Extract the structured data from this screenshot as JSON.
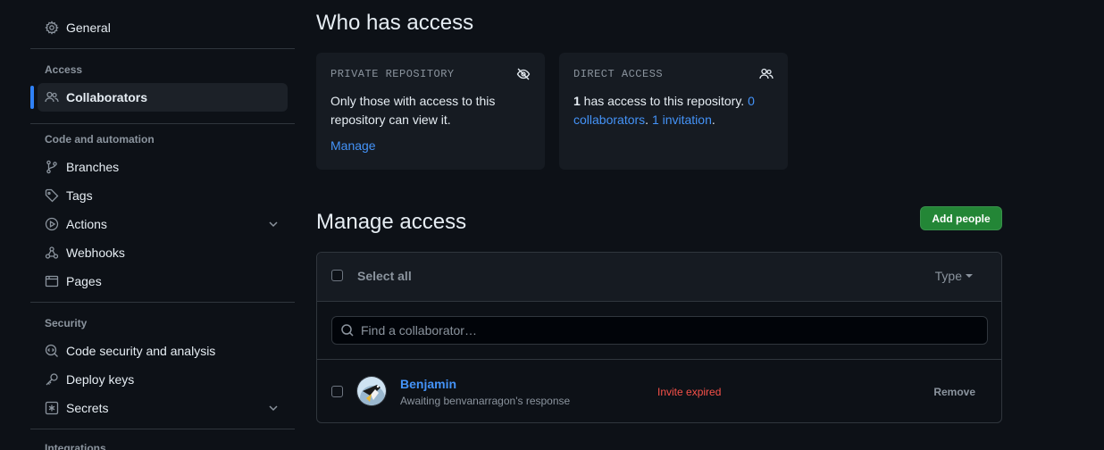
{
  "sidebar": {
    "general": "General",
    "sections": {
      "access": "Access",
      "code": "Code and automation",
      "security": "Security",
      "integrations": "Integrations"
    },
    "items": {
      "collaborators": "Collaborators",
      "branches": "Branches",
      "tags": "Tags",
      "actions": "Actions",
      "webhooks": "Webhooks",
      "pages": "Pages",
      "code_security": "Code security and analysis",
      "deploy_keys": "Deploy keys",
      "secrets": "Secrets"
    }
  },
  "who_has_access": {
    "title": "Who has access",
    "private_card": {
      "heading": "PRIVATE REPOSITORY",
      "body": "Only those with access to this repository can view it.",
      "manage_link": "Manage"
    },
    "direct_card": {
      "heading": "DIRECT ACCESS",
      "count": "1",
      "text": " has access to this repository. ",
      "collaborators_link": "0 collaborators",
      "sep": ". ",
      "invitation_link": "1 invitation",
      "end": "."
    }
  },
  "manage_access": {
    "title": "Manage access",
    "add_button": "Add people",
    "select_all": "Select all",
    "type_filter": "Type",
    "search_placeholder": "Find a collaborator…",
    "members": [
      {
        "name": "Benjamin",
        "subtitle": "Awaiting benvanarragon's response",
        "status": "Invite expired",
        "action": "Remove"
      }
    ]
  },
  "colors": {
    "background": "#0d1117",
    "card": "#161b22",
    "link": "#4493f8",
    "accent_active": "#2f81f7",
    "primary_button": "#238636",
    "danger": "#f85149"
  }
}
